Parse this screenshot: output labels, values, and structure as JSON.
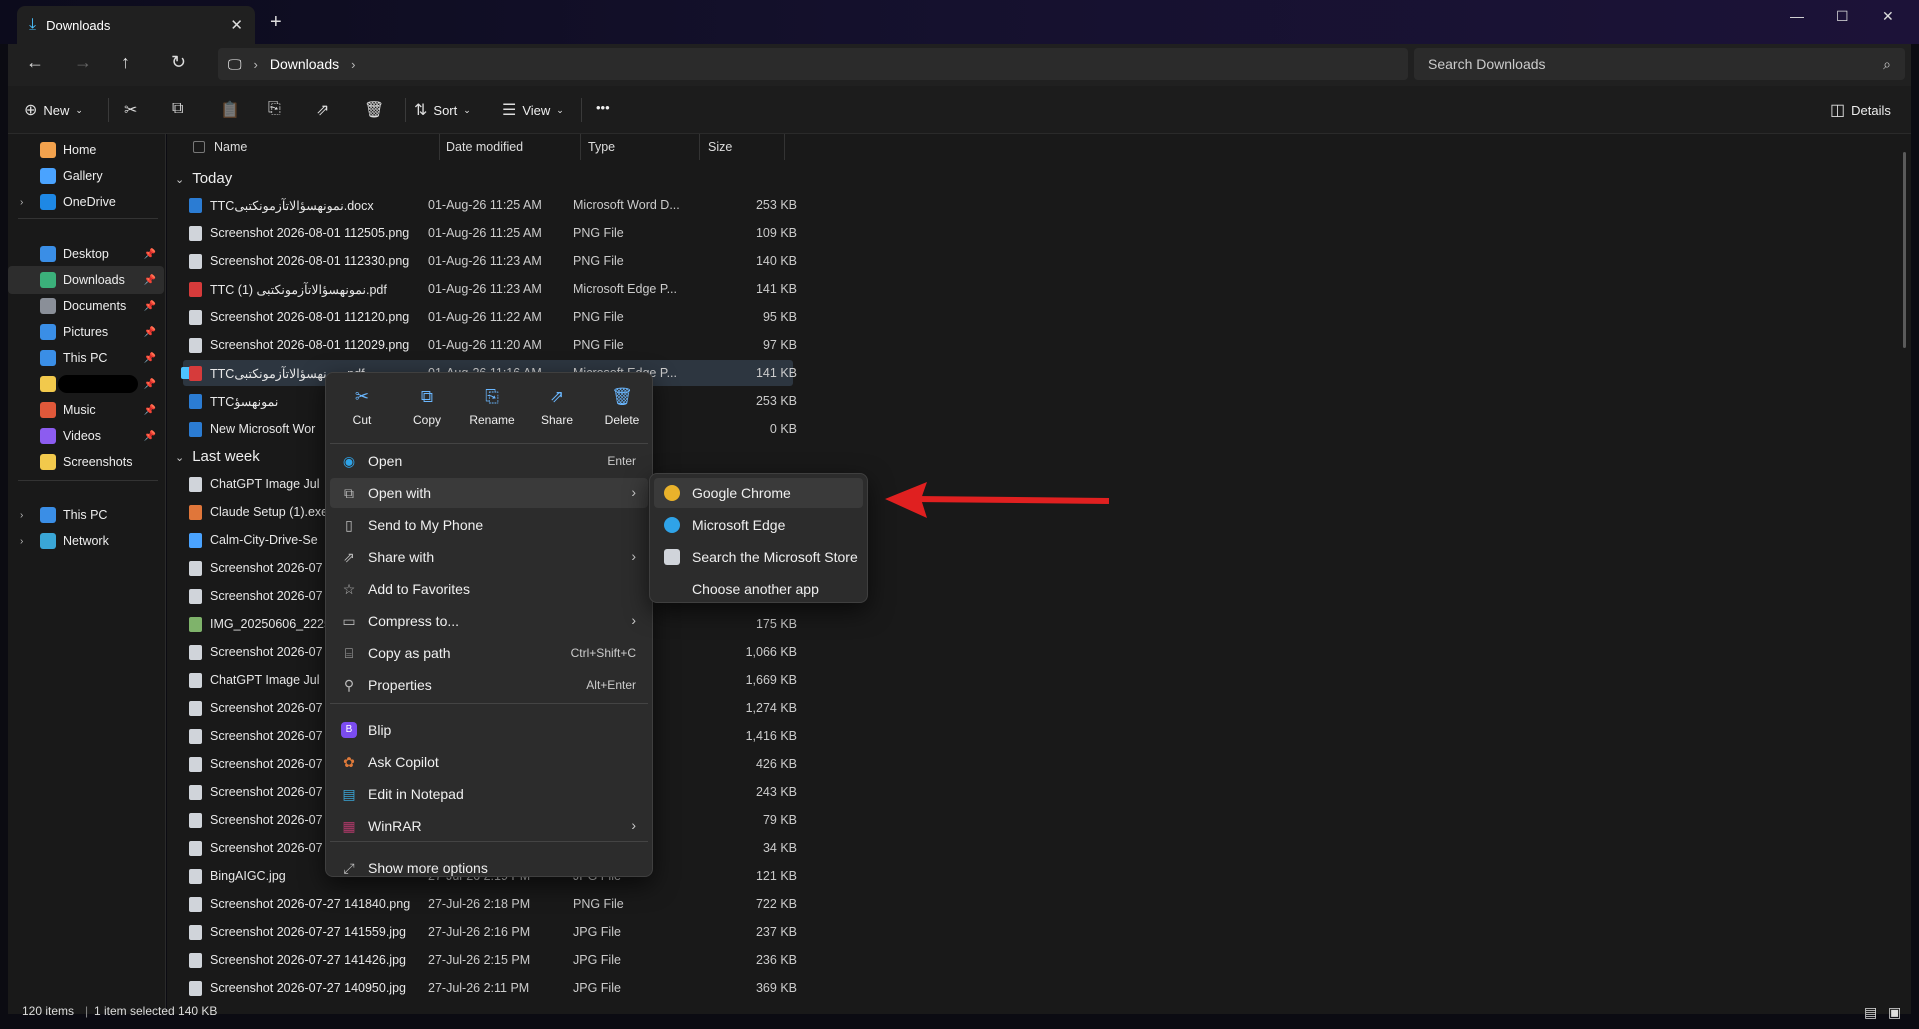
{
  "window": {
    "tab_title": "Downloads",
    "tab_close": "✕",
    "new_tab": "+"
  },
  "nav": {
    "path_root_icon": "pc-icon",
    "breadcrumb": "Downloads",
    "search_placeholder": "Search Downloads"
  },
  "toolbar": {
    "new_label": "New",
    "sort_label": "Sort",
    "view_label": "View",
    "more_label": "•••",
    "details_label": "Details"
  },
  "sidebar": {
    "items": [
      {
        "label": "Home",
        "color": "#f3a24d",
        "expand": ""
      },
      {
        "label": "Gallery",
        "color": "#4aa3ff",
        "expand": ""
      },
      {
        "label": "OneDrive",
        "color": "#1e88e5",
        "expand": "›"
      },
      {
        "label": "Desktop",
        "color": "#3a8ee6",
        "expand": ""
      },
      {
        "label": "Downloads",
        "color": "#3bb07a",
        "expand": ""
      },
      {
        "label": "Documents",
        "color": "#8a8f98",
        "expand": ""
      },
      {
        "label": "Pictures",
        "color": "#3a8ee6",
        "expand": ""
      },
      {
        "label": "This PC",
        "color": "#3a8ee6",
        "expand": ""
      },
      {
        "label": "",
        "color": "#f2c94c",
        "expand": ""
      },
      {
        "label": "Music",
        "color": "#e0583a",
        "expand": ""
      },
      {
        "label": "Videos",
        "color": "#8c5cf0",
        "expand": ""
      },
      {
        "label": "Screenshots",
        "color": "#f2c94c",
        "expand": ""
      },
      {
        "label": "This PC",
        "color": "#3a8ee6",
        "expand": "›"
      },
      {
        "label": "Network",
        "color": "#3aa6d6",
        "expand": "›"
      }
    ]
  },
  "columns": {
    "name": "Name",
    "date": "Date modified",
    "type": "Type",
    "size": "Size"
  },
  "groups": {
    "today": "Today",
    "last_week": "Last week"
  },
  "files_today": [
    {
      "name": "TTCنمونهسؤالاتآزمونکتبی.docx",
      "date": "01-Aug-26 11:25 AM",
      "type": "Microsoft Word D...",
      "size": "253 KB",
      "color": "#2b7cd3"
    },
    {
      "name": "Screenshot 2026-08-01 112505.png",
      "date": "01-Aug-26 11:25 AM",
      "type": "PNG File",
      "size": "109 KB",
      "color": "#d0d4da"
    },
    {
      "name": "Screenshot 2026-08-01 112330.png",
      "date": "01-Aug-26 11:23 AM",
      "type": "PNG File",
      "size": "140 KB",
      "color": "#d0d4da"
    },
    {
      "name": "TTC نمونهسؤالاتآزمونکتبی (1).pdf",
      "date": "01-Aug-26 11:23 AM",
      "type": "Microsoft Edge P...",
      "size": "141 KB",
      "color": "#d63b3b"
    },
    {
      "name": "Screenshot 2026-08-01 112120.png",
      "date": "01-Aug-26 11:22 AM",
      "type": "PNG File",
      "size": "95 KB",
      "color": "#d0d4da"
    },
    {
      "name": "Screenshot 2026-08-01 112029.png",
      "date": "01-Aug-26 11:20 AM",
      "type": "PNG File",
      "size": "97 KB",
      "color": "#d0d4da"
    },
    {
      "name": "TTCنمونهسؤالاتآزمونکتبی.pdf",
      "date": "01-Aug-26 11:16 AM",
      "type": "Microsoft Edge P...",
      "size": "141 KB",
      "color": "#d63b3b"
    },
    {
      "name": "TTCنمونهسؤ",
      "date": "",
      "type": "Word D...",
      "size": "253 KB",
      "color": "#2b7cd3"
    },
    {
      "name": "New Microsoft Wor",
      "date": "",
      "type": "Word D...",
      "size": "0 KB",
      "color": "#2b7cd3"
    }
  ],
  "files_last_week": [
    {
      "name": "ChatGPT Image Jul",
      "date": "",
      "type": "",
      "size": "",
      "color": "#d0d4da"
    },
    {
      "name": "Claude Setup (1).exe",
      "date": "",
      "type": "",
      "size": "",
      "color": "#e0763a"
    },
    {
      "name": "Calm-City-Drive-Se",
      "date": "",
      "type": "",
      "size": "",
      "color": "#4aa3ff"
    },
    {
      "name": "Screenshot 2026-07",
      "date": "",
      "type": "",
      "size": "",
      "color": "#d0d4da"
    },
    {
      "name": "Screenshot 2026-07",
      "date": "",
      "type": "",
      "size": "",
      "color": "#d0d4da"
    },
    {
      "name": "IMG_20250606_2225",
      "date": "",
      "type": "ML Do...",
      "size": "175 KB",
      "color": "#7fb36b"
    },
    {
      "name": "Screenshot 2026-07",
      "date": "",
      "type": "",
      "size": "1,066 KB",
      "color": "#d0d4da"
    },
    {
      "name": "ChatGPT Image Jul",
      "date": "",
      "type": "",
      "size": "1,669 KB",
      "color": "#d0d4da"
    },
    {
      "name": "Screenshot 2026-07",
      "date": "",
      "type": "",
      "size": "1,274 KB",
      "color": "#d0d4da"
    },
    {
      "name": "Screenshot 2026-07",
      "date": "",
      "type": "",
      "size": "1,416 KB",
      "color": "#d0d4da"
    },
    {
      "name": "Screenshot 2026-07",
      "date": "",
      "type": "",
      "size": "426 KB",
      "color": "#d0d4da"
    },
    {
      "name": "Screenshot 2026-07",
      "date": "",
      "type": "",
      "size": "243 KB",
      "color": "#d0d4da"
    },
    {
      "name": "Screenshot 2026-07",
      "date": "",
      "type": "",
      "size": "79 KB",
      "color": "#d0d4da"
    },
    {
      "name": "Screenshot 2026-07",
      "date": "",
      "type": "",
      "size": "34 KB",
      "color": "#d0d4da"
    },
    {
      "name": "BingAIGC.jpg",
      "date": "27-Jul-26 2:19 PM",
      "type": "JPG File",
      "size": "121 KB",
      "color": "#d0d4da"
    },
    {
      "name": "Screenshot 2026-07-27 141840.png",
      "date": "27-Jul-26 2:18 PM",
      "type": "PNG File",
      "size": "722 KB",
      "color": "#d0d4da"
    },
    {
      "name": "Screenshot 2026-07-27 141559.jpg",
      "date": "27-Jul-26 2:16 PM",
      "type": "JPG File",
      "size": "237 KB",
      "color": "#d0d4da"
    },
    {
      "name": "Screenshot 2026-07-27 141426.jpg",
      "date": "27-Jul-26 2:15 PM",
      "type": "JPG File",
      "size": "236 KB",
      "color": "#d0d4da"
    },
    {
      "name": "Screenshot 2026-07-27 140950.jpg",
      "date": "27-Jul-26 2:11 PM",
      "type": "JPG File",
      "size": "369 KB",
      "color": "#d0d4da"
    }
  ],
  "context_menu": {
    "quick_actions": [
      "Cut",
      "Copy",
      "Rename",
      "Share",
      "Delete"
    ],
    "items": [
      {
        "label": "Open",
        "shortcut": "Enter",
        "arrow": "",
        "icon": "◉",
        "color": "#2fa3e8"
      },
      {
        "label": "Open with",
        "shortcut": "",
        "arrow": "›",
        "icon": "⧉",
        "color": "#bbbbbb"
      },
      {
        "label": "Send to My Phone",
        "shortcut": "",
        "arrow": "",
        "icon": "▯",
        "color": "#bbbbbb"
      },
      {
        "label": "Share with",
        "shortcut": "",
        "arrow": "›",
        "icon": "⇗",
        "color": "#bbbbbb"
      },
      {
        "label": "Add to Favorites",
        "shortcut": "",
        "arrow": "",
        "icon": "☆",
        "color": "#bbbbbb"
      },
      {
        "label": "Compress to...",
        "shortcut": "",
        "arrow": "›",
        "icon": "▭",
        "color": "#bbbbbb"
      },
      {
        "label": "Copy as path",
        "shortcut": "Ctrl+Shift+C",
        "arrow": "",
        "icon": "⌸",
        "color": "#bbbbbb"
      },
      {
        "label": "Properties",
        "shortcut": "Alt+Enter",
        "arrow": "",
        "icon": "⚲",
        "color": "#bbbbbb"
      },
      {
        "label": "Blip",
        "shortcut": "",
        "arrow": "",
        "icon": "B",
        "color": "#7b4cf0"
      },
      {
        "label": "Ask Copilot",
        "shortcut": "",
        "arrow": "",
        "icon": "✿",
        "color": "#e07a3a"
      },
      {
        "label": "Edit in Notepad",
        "shortcut": "",
        "arrow": "",
        "icon": "▤",
        "color": "#3aa6d6"
      },
      {
        "label": "WinRAR",
        "shortcut": "",
        "arrow": "›",
        "icon": "▦",
        "color": "#b0396a"
      },
      {
        "label": "Show more options",
        "shortcut": "",
        "arrow": "",
        "icon": "⤢",
        "color": "#bbbbbb"
      }
    ]
  },
  "open_with_submenu": [
    {
      "label": "Google Chrome",
      "color": "#e9b22b"
    },
    {
      "label": "Microsoft Edge",
      "color": "#2fa3e8"
    },
    {
      "label": "Search the Microsoft Store",
      "color": "#d0d4da"
    },
    {
      "label": "Choose another app",
      "color": ""
    }
  ],
  "statusbar": {
    "items": "120 items",
    "selected": "1 item selected  140 KB"
  },
  "annotation_color": "#e02020"
}
